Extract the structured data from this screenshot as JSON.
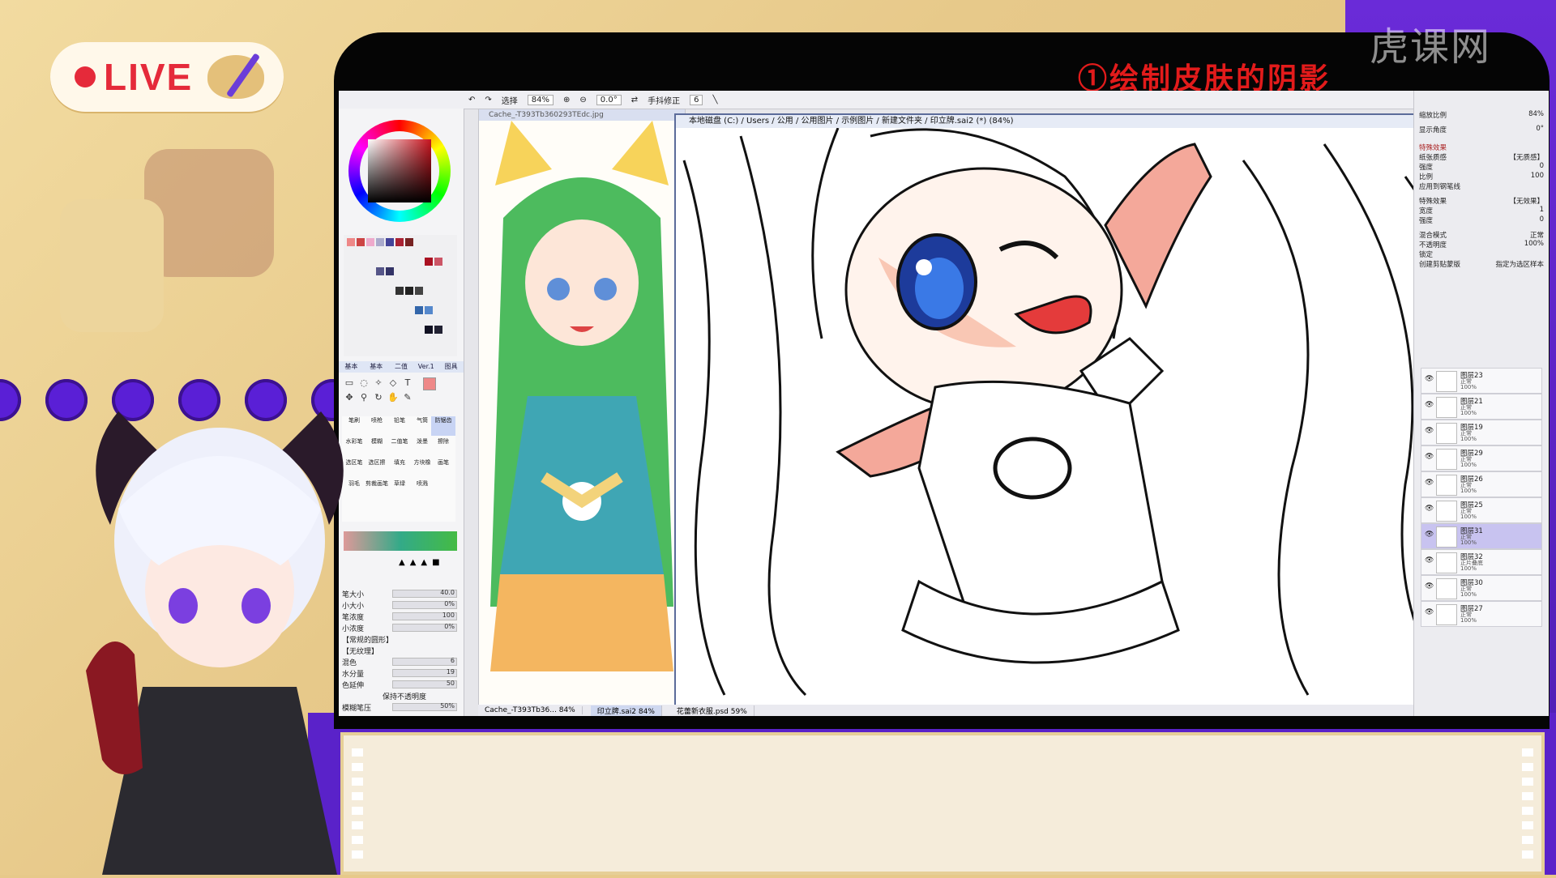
{
  "stream": {
    "live_label": "LIVE",
    "lesson_title": "①绘制皮肤的阴影",
    "watermark": "虎课网"
  },
  "toolbar": {
    "selection_label": "选择",
    "zoom": "84%",
    "rotation": "0.0°",
    "stabilizer_label": "手抖修正",
    "stabilizer_value": "6"
  },
  "tool_panel": {
    "tabs": [
      "基本",
      "基本",
      "二值",
      "Ver.1",
      "图具"
    ],
    "brushes": [
      "笔刷",
      "喷枪",
      "铅笔",
      "气筒",
      "防锯齿",
      "水彩笔",
      "模糊",
      "二值笔",
      "泼墨",
      "擦除",
      "选区笔",
      "选区擦",
      "填充",
      "方块橡",
      "画笔",
      "羽毛",
      "剪裁画笔",
      "草绿",
      "喷溅"
    ],
    "props": [
      {
        "label": "笔大小",
        "value": "40.0"
      },
      {
        "label": "小大小",
        "value": "0%"
      },
      {
        "label": "笔浓度",
        "value": "100"
      },
      {
        "label": "小浓度",
        "value": "0%"
      },
      {
        "label": "【常规的圆形】",
        "value": ""
      },
      {
        "label": "【无纹理】",
        "value": ""
      },
      {
        "label": "混色",
        "value": "6"
      },
      {
        "label": "水分量",
        "value": "19"
      },
      {
        "label": "色延伸",
        "value": "50"
      },
      {
        "label": "保持不透明度",
        "value": ""
      },
      {
        "label": "模糊笔压",
        "value": "50%"
      }
    ]
  },
  "ref_panel": {
    "title": "Cache_-T393Tb360293TEdc.jpg"
  },
  "canvas_panel": {
    "title": "本地磁盘 (C:) / Users / 公用 / 公用图片 / 示例图片 / 新建文件夹 / 印立牌.sai2 (*) (84%)"
  },
  "layer_panel": {
    "zoom_label": "缩放比例",
    "zoom_value": "84%",
    "angle_label": "显示角度",
    "angle_value": "0°",
    "effects_header": "特殊效果",
    "texture_label": "纸张质感",
    "texture_value": "【无质感】",
    "strength_label": "强度",
    "strength_value": "0",
    "ratio_label": "比例",
    "ratio_value": "100",
    "apply_pen_label": "应用到钢笔线",
    "effect_label": "特殊效果",
    "effect_value": "【无效果】",
    "width_label": "宽度",
    "width_value": "1",
    "intensity_label": "强度",
    "intensity_value": "0",
    "blend_label": "混合模式",
    "blend_value": "正常",
    "opacity_label": "不透明度",
    "opacity_value": "100%",
    "lock_label": "锁定",
    "clip_label": "创建剪贴蒙版",
    "select_source_label": "指定为选区样本",
    "layers": [
      {
        "name": "图层23",
        "mode": "正常",
        "opacity": "100%",
        "selected": false
      },
      {
        "name": "图层21",
        "mode": "正常",
        "opacity": "100%",
        "selected": false
      },
      {
        "name": "图层19",
        "mode": "正常",
        "opacity": "100%",
        "selected": false
      },
      {
        "name": "图层29",
        "mode": "正常",
        "opacity": "100%",
        "selected": false
      },
      {
        "name": "图层26",
        "mode": "正常",
        "opacity": "100%",
        "selected": false
      },
      {
        "name": "图层25",
        "mode": "正常",
        "opacity": "100%",
        "selected": false
      },
      {
        "name": "图层31",
        "mode": "正常",
        "opacity": "100%",
        "selected": true
      },
      {
        "name": "图层32",
        "mode": "正片叠底",
        "opacity": "100%",
        "selected": false
      },
      {
        "name": "图层30",
        "mode": "正常",
        "opacity": "100%",
        "selected": false
      },
      {
        "name": "图层27",
        "mode": "正常",
        "opacity": "100%",
        "selected": false
      }
    ]
  },
  "statusbar": {
    "docs": [
      {
        "name": "Cache_-T393Tb36...",
        "zoom": "84%"
      },
      {
        "name": "印立牌.sai2",
        "zoom": "84%"
      },
      {
        "name": "花蕾新衣服.psd",
        "zoom": "59%"
      }
    ]
  },
  "colors": {
    "accent_purple": "#5a22c9",
    "live_red": "#e52a3a",
    "title_red": "#e21b1b",
    "background_gold": "#e7c98a"
  }
}
